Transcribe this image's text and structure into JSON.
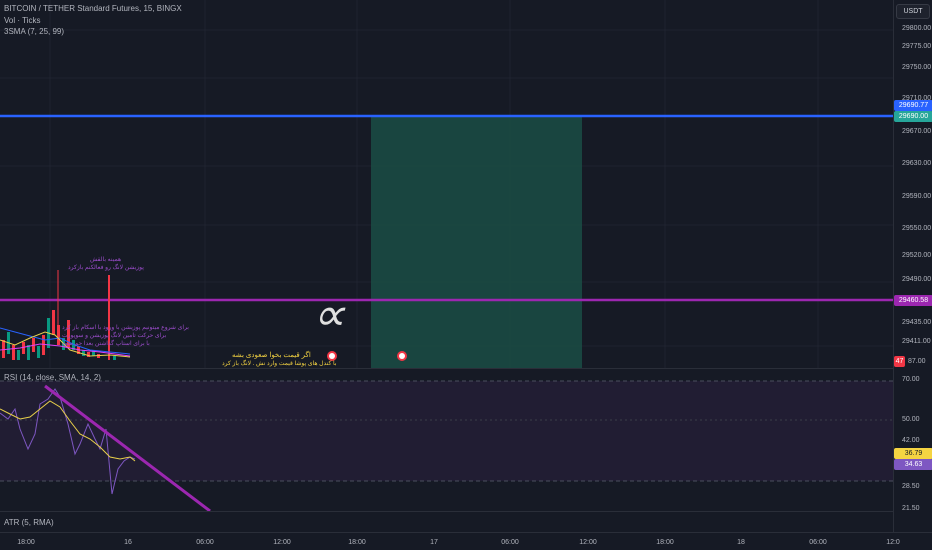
{
  "legend": {
    "symbol": "BITCOIN / TETHER Standard Futures, 15, BINGX",
    "volume": "Vol · Ticks",
    "sma": "3SMA (7, 25, 99)"
  },
  "currency_button": "USDT",
  "price_ticks": [
    "29800.00",
    "29775.00",
    "29750.00",
    "29710.00",
    "29670.00",
    "29630.00",
    "29590.00",
    "29550.00",
    "29520.00",
    "29490.00",
    "29435.00",
    "29411.00"
  ],
  "price_badges": {
    "blue_line": "29690.77",
    "green": "29690.00",
    "purple_line": "29460.58",
    "red_count": "47",
    "red_price": "87.00"
  },
  "annotations": {
    "note_top_1": "همینه بالقش",
    "note_top_2": "پوزیشن لانگ رو فعالکنم بازکرد",
    "note_mid_1": "برای شروع میتونیم پوزیشن با ورود با اسکام باز کرد",
    "note_mid_2": "برای حرکت تامین لانگ پوزیشن و سوپورت",
    "note_mid_3": "با برای استاپ گذاشتن بعدا جم سود",
    "yellow_1": "اگر قیمت بخوا صعودی بشه",
    "yellow_2": "با کندل های پوشا قیمت وارد نش . لانگ باز کرد",
    "alpha": "∝"
  },
  "rsi": {
    "label": "RSI (14, close, SMA, 14, 2)",
    "ticks": [
      "70.00",
      "50.00",
      "42.00",
      "28.50"
    ],
    "value_1": "36.79",
    "value_2": "34.63"
  },
  "atr": {
    "label": "ATR (5, RMA)",
    "tick": "21.50"
  },
  "time_ticks": [
    "18:00",
    "16",
    "06:00",
    "12:00",
    "18:00",
    "17",
    "06:00",
    "12:00",
    "18:00",
    "18",
    "06:00",
    "12:0"
  ],
  "colors": {
    "background": "#161a25",
    "blue_line": "#2962ff",
    "purple_line": "#9c27b0",
    "long_zone": "#1a4a44",
    "rsi_band": "#211d33",
    "yellow_text": "#f5d442",
    "red_badge": "#f23645",
    "green_badge": "#26a69a"
  }
}
